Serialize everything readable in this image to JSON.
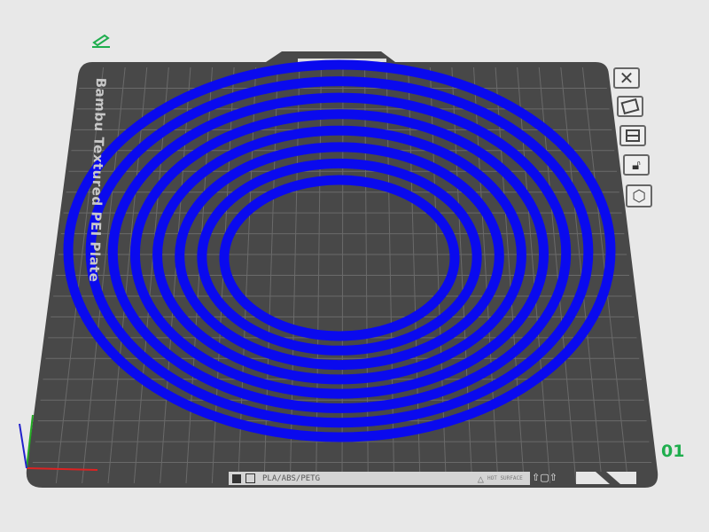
{
  "plate": {
    "name_label": "Bambu Textured PEI Plate",
    "filament_label": "PLA/ABS/PETG",
    "hot_surface_label": "HOT SURFACE",
    "plate_number": "01"
  },
  "toolbar_icons": [
    "close-icon",
    "auto-orient-icon",
    "arrange-icon",
    "lock-icon",
    "settings-hex-icon"
  ],
  "colors": {
    "object": "#0a0aee",
    "plate": "#4a4a4a",
    "grid": "#6c6c6c",
    "accent": "#1fae4e"
  },
  "rings": 8
}
